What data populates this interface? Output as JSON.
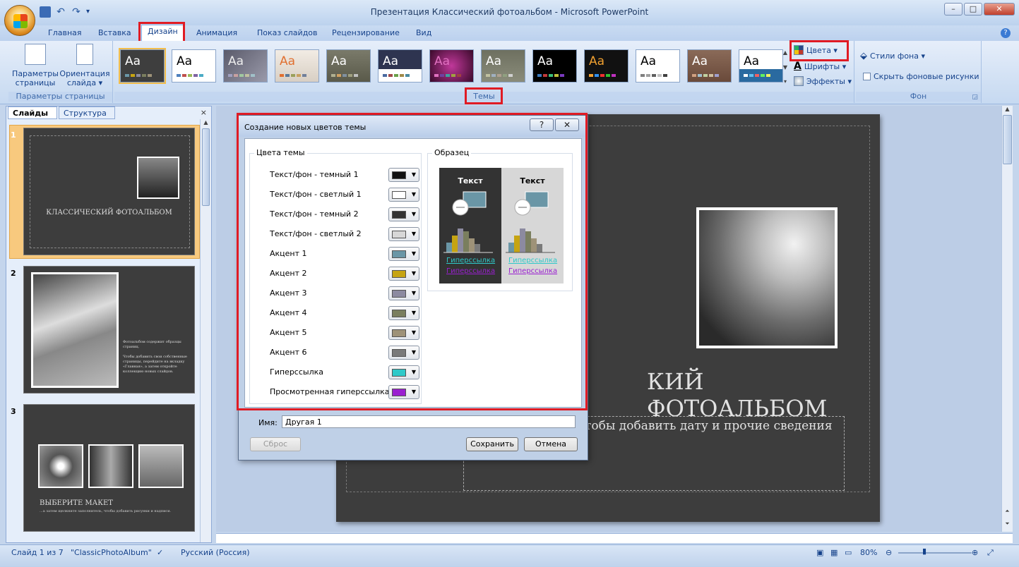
{
  "window": {
    "title": "Презентация Классический фотоальбом - Microsoft PowerPoint"
  },
  "tabs": [
    {
      "label": "Главная"
    },
    {
      "label": "Вставка"
    },
    {
      "label": "Дизайн"
    },
    {
      "label": "Анимация"
    },
    {
      "label": "Показ слайдов"
    },
    {
      "label": "Рецензирование"
    },
    {
      "label": "Вид"
    }
  ],
  "ribbon": {
    "page_setup": {
      "btn1": "Параметры\nстраницы",
      "btn2": "Ориентация\nслайда ▾",
      "label": "Параметры страницы"
    },
    "themes": {
      "label": "Темы",
      "thumb_text": "Aa",
      "colors": "Цвета ▾",
      "fonts": "Шрифты ▾",
      "effects": "Эффекты ▾"
    },
    "background": {
      "styles": "Стили фона ▾",
      "hide": "Скрыть фоновые рисунки",
      "label": "Фон"
    }
  },
  "pane": {
    "tab_slides": "Слайды",
    "tab_outline": "Структура",
    "close": "×",
    "slide1_title": "КЛАССИЧЕСКИЙ ФОТОАЛЬБОМ",
    "slide2_text": "Фотоальбом содержит образцы страниц.\n\nЧтобы добавить свои собственные страницы, перейдите на вкладку «Главная», а затем откройте коллекцию новых слайдов.",
    "slide3_title": "ВЫБЕРИТЕ МАКЕТ",
    "slide3_text": "...а затем щелкните заполнитель, чтобы добавить рисунки и надписи.",
    "nums": [
      "1",
      "2",
      "3"
    ]
  },
  "slide": {
    "title": "КИЙ ФОТОАЛЬБОМ",
    "subtitle": "тобы добавить дату и прочие сведения"
  },
  "dialog": {
    "title": "Создание новых цветов темы",
    "help": "?",
    "close": "✕",
    "theme_colors_legend": "Цвета темы",
    "sample_legend": "Образец",
    "rows": [
      {
        "label": "Текст/фон - темный 1",
        "color": "#111111"
      },
      {
        "label": "Текст/фон - светлый 1",
        "color": "#ffffff"
      },
      {
        "label": "Текст/фон - темный 2",
        "color": "#333333"
      },
      {
        "label": "Текст/фон - светлый 2",
        "color": "#d7d7d7"
      },
      {
        "label": "Акцент 1",
        "color": "#6a96a6"
      },
      {
        "label": "Акцент 2",
        "color": "#c6a412"
      },
      {
        "label": "Акцент 3",
        "color": "#8c8aa0"
      },
      {
        "label": "Акцент 4",
        "color": "#7a7e5e"
      },
      {
        "label": "Акцент 5",
        "color": "#9e9278"
      },
      {
        "label": "Акцент 6",
        "color": "#7a7a7a"
      },
      {
        "label": "Гиперссылка",
        "color": "#2ec9c9"
      },
      {
        "label": "Просмотренная гиперссылка",
        "color": "#9a1fd0"
      }
    ],
    "sample_text": "Текст",
    "sample_link": "Гиперссылка",
    "name_label": "Имя:",
    "name_value": "Другая 1",
    "reset": "Сброс",
    "save": "Сохранить",
    "cancel": "Отмена"
  },
  "status": {
    "slide_info": "Слайд 1 из 7",
    "theme": "\"ClassicPhotoAlbum\"",
    "language": "Русский (Россия)",
    "zoom": "80%"
  },
  "colors": {
    "highlight_red": "#e01b24",
    "accent_bars": [
      "#6a96a6",
      "#c6a412",
      "#8c8aa0",
      "#7a7e5e",
      "#9e9278",
      "#7a7a7a"
    ],
    "link": "#2ec9c9",
    "visited": "#9a1fd0"
  }
}
